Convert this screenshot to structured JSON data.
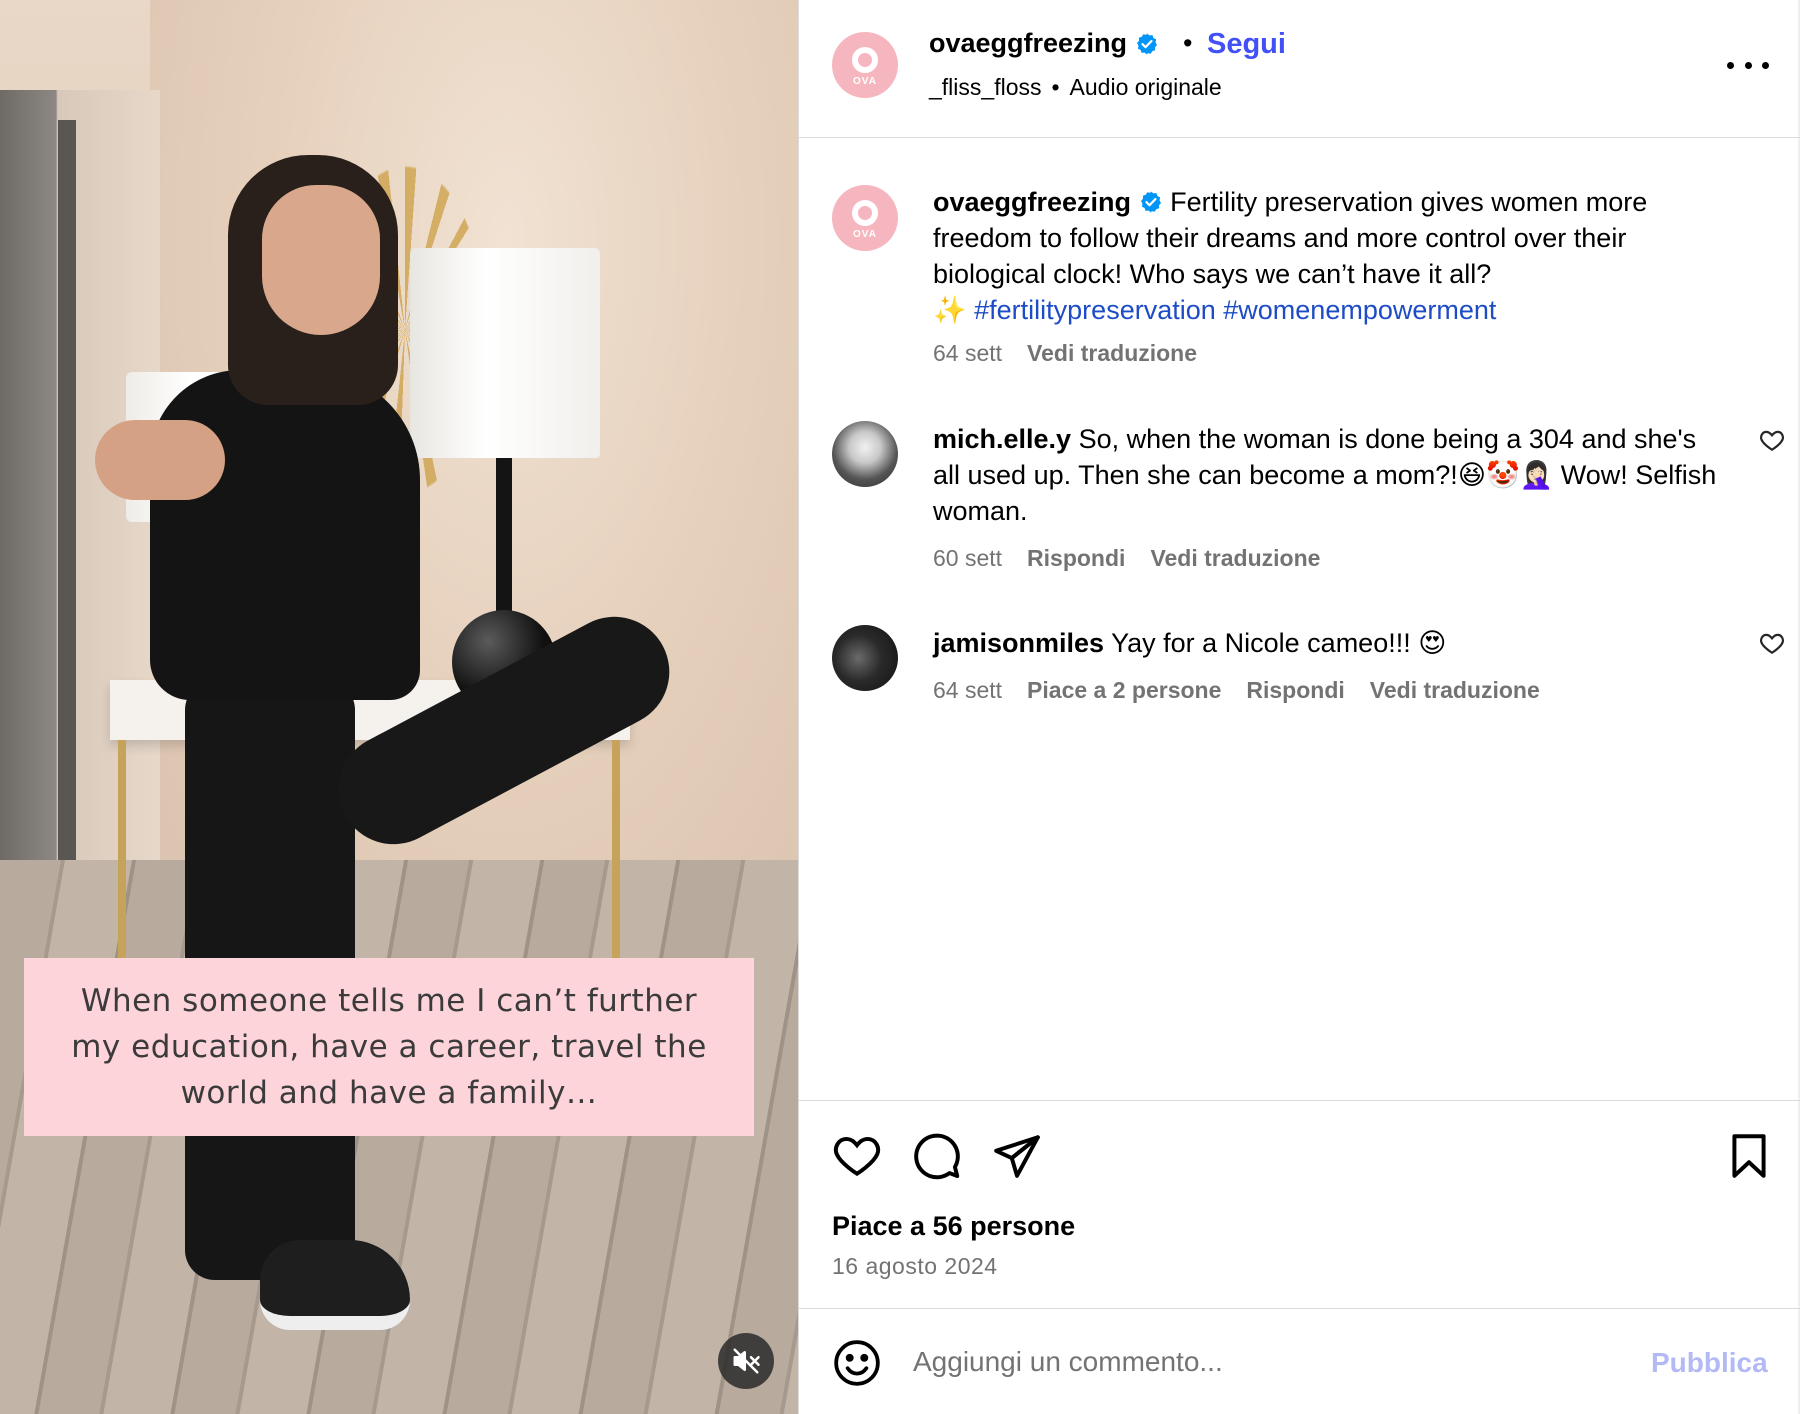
{
  "media": {
    "overlay_caption": "When someone tells me I can’t further my education, have a career, travel the world and have a family…",
    "mute_icon": "speaker-muted-icon"
  },
  "header": {
    "username": "ovaeggfreezing",
    "avatar_text": "OVA",
    "dot": "•",
    "follow_label": "Segui",
    "audio_author": "_fliss_floss",
    "audio_sep": "•",
    "audio_label": "Audio originale"
  },
  "caption": {
    "username": "ovaeggfreezing",
    "text": "Fertility preservation gives women more freedom to follow their dreams and more control over their biological clock! Who says we can’t have it all?",
    "sparkle": "✨",
    "hashtag1": "#fertilitypreservation",
    "hashtag2": "#womenempowerment",
    "time": "64 sett",
    "translate": "Vedi traduzione"
  },
  "comments": [
    {
      "username": "mich.elle.y",
      "text": "So, when the woman is done being a 304 and she's all used up. Then she can become a mom?!😆🤡🤦🏻‍♀️ Wow! Selfish woman.",
      "time": "60 sett",
      "reply": "Rispondi",
      "translate": "Vedi traduzione"
    },
    {
      "username": "jamisonmiles",
      "text": "Yay for a Nicole cameo!!! 😍",
      "time": "64 sett",
      "likes": "Piace a 2 persone",
      "reply": "Rispondi",
      "translate": "Vedi traduzione"
    }
  ],
  "actions": {
    "likes": "Piace a 56 persone",
    "date": "16 agosto 2024"
  },
  "add_comment": {
    "placeholder": "Aggiungi un commento...",
    "publish": "Pubblica"
  },
  "colors": {
    "accent": "#4150f7",
    "hashtag": "#1e4cc6",
    "muted_text": "#737373",
    "verified": "#0095f6",
    "caption_bg": "#fdd4da",
    "publish_disabled": "#b3b9f4"
  }
}
